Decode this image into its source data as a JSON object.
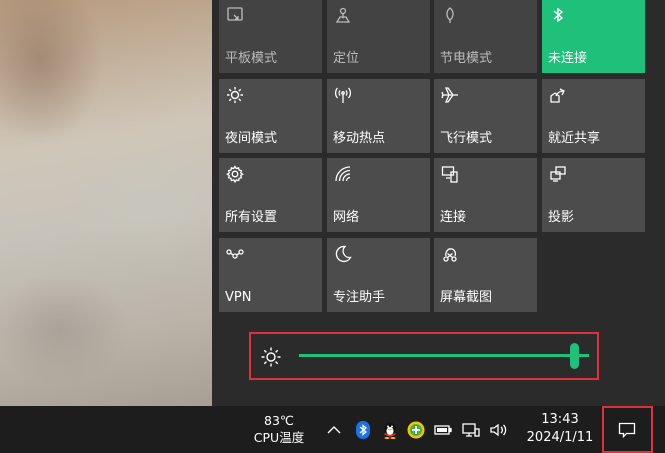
{
  "tiles": [
    {
      "label": "平板模式",
      "icon": "tablet-mode-icon",
      "state": "dim"
    },
    {
      "label": "定位",
      "icon": "location-icon",
      "state": "dim"
    },
    {
      "label": "节电模式",
      "icon": "battery-saver-icon",
      "state": "dim"
    },
    {
      "label": "未连接",
      "icon": "bluetooth-icon",
      "state": "on"
    },
    {
      "label": "夜间模式",
      "icon": "night-light-icon",
      "state": "normal"
    },
    {
      "label": "移动热点",
      "icon": "mobile-hotspot-icon",
      "state": "normal"
    },
    {
      "label": "飞行模式",
      "icon": "airplane-icon",
      "state": "normal"
    },
    {
      "label": "就近共享",
      "icon": "nearby-share-icon",
      "state": "normal"
    },
    {
      "label": "所有设置",
      "icon": "gear-icon",
      "state": "normal"
    },
    {
      "label": "网络",
      "icon": "network-icon",
      "state": "normal"
    },
    {
      "label": "连接",
      "icon": "connect-icon",
      "state": "normal"
    },
    {
      "label": "投影",
      "icon": "project-icon",
      "state": "normal"
    },
    {
      "label": "VPN",
      "icon": "vpn-icon",
      "state": "normal"
    },
    {
      "label": "专注助手",
      "icon": "focus-assist-icon",
      "state": "normal"
    },
    {
      "label": "屏幕截图",
      "icon": "screen-snip-icon",
      "state": "normal"
    }
  ],
  "brightness": {
    "level": 0.95,
    "icon": "brightness-sun-icon"
  },
  "taskbar": {
    "temp_value": "83℃",
    "temp_label": "CPU温度",
    "time": "13:43",
    "date": "2024/1/11"
  },
  "colors": {
    "accent": "#1ec07a",
    "highlight": "#e0313a"
  }
}
